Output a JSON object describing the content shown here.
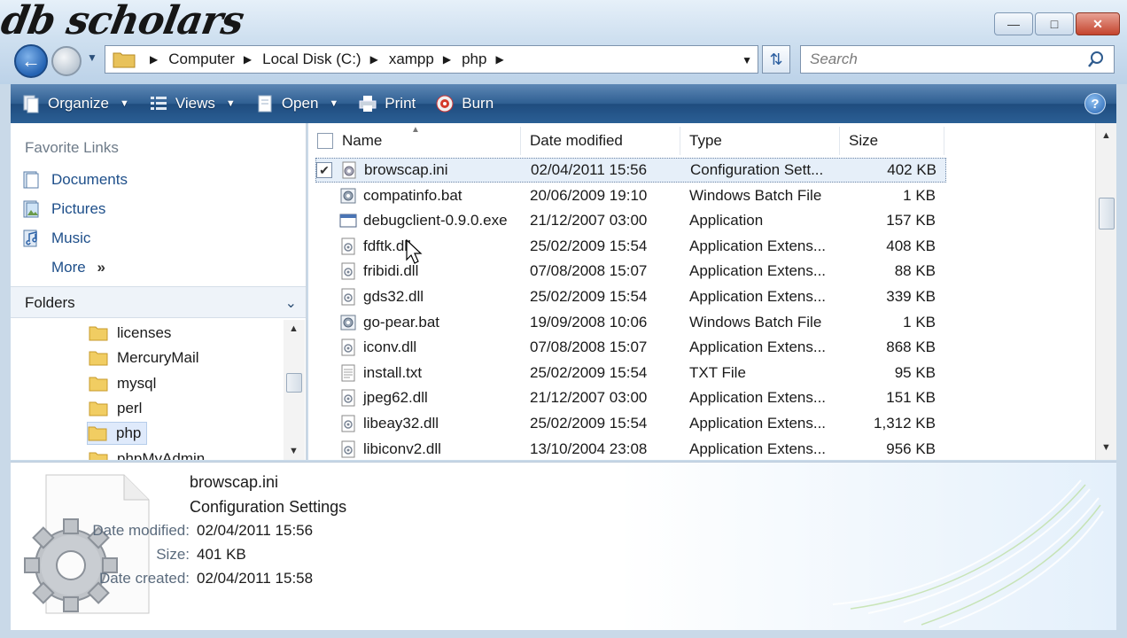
{
  "watermark": "db scholars",
  "address": {
    "crumbs": [
      "Computer",
      "Local Disk (C:)",
      "xampp",
      "php"
    ]
  },
  "search": {
    "placeholder": "Search"
  },
  "toolbar": {
    "organize": "Organize",
    "views": "Views",
    "open": "Open",
    "print": "Print",
    "burn": "Burn"
  },
  "nav": {
    "favorites_heading": "Favorite Links",
    "links": [
      "Documents",
      "Pictures",
      "Music"
    ],
    "more": "More",
    "folders_label": "Folders",
    "tree": [
      "licenses",
      "MercuryMail",
      "mysql",
      "perl",
      "php",
      "phpMyAdmin"
    ],
    "selected_folder": "php"
  },
  "columns": {
    "name": "Name",
    "date": "Date modified",
    "type": "Type",
    "size": "Size"
  },
  "files": [
    {
      "name": "browscap.ini",
      "date": "02/04/2011 15:56",
      "type": "Configuration Sett...",
      "size": "402 KB",
      "icon": "settings-file-icon",
      "selected": true
    },
    {
      "name": "compatinfo.bat",
      "date": "20/06/2009 19:10",
      "type": "Windows Batch File",
      "size": "1 KB",
      "icon": "batch-file-icon"
    },
    {
      "name": "debugclient-0.9.0.exe",
      "date": "21/12/2007 03:00",
      "type": "Application",
      "size": "157 KB",
      "icon": "exe-file-icon"
    },
    {
      "name": "fdftk.dll",
      "date": "25/02/2009 15:54",
      "type": "Application Extens...",
      "size": "408 KB",
      "icon": "dll-file-icon"
    },
    {
      "name": "fribidi.dll",
      "date": "07/08/2008 15:07",
      "type": "Application Extens...",
      "size": "88 KB",
      "icon": "dll-file-icon"
    },
    {
      "name": "gds32.dll",
      "date": "25/02/2009 15:54",
      "type": "Application Extens...",
      "size": "339 KB",
      "icon": "dll-file-icon"
    },
    {
      "name": "go-pear.bat",
      "date": "19/09/2008 10:06",
      "type": "Windows Batch File",
      "size": "1 KB",
      "icon": "batch-file-icon"
    },
    {
      "name": "iconv.dll",
      "date": "07/08/2008 15:07",
      "type": "Application Extens...",
      "size": "868 KB",
      "icon": "dll-file-icon"
    },
    {
      "name": "install.txt",
      "date": "25/02/2009 15:54",
      "type": "TXT File",
      "size": "95 KB",
      "icon": "text-file-icon"
    },
    {
      "name": "jpeg62.dll",
      "date": "21/12/2007 03:00",
      "type": "Application Extens...",
      "size": "151 KB",
      "icon": "dll-file-icon"
    },
    {
      "name": "libeay32.dll",
      "date": "25/02/2009 15:54",
      "type": "Application Extens...",
      "size": "1,312 KB",
      "icon": "dll-file-icon"
    },
    {
      "name": "libiconv2.dll",
      "date": "13/10/2004 23:08",
      "type": "Application Extens...",
      "size": "956 KB",
      "icon": "dll-file-icon"
    }
  ],
  "details": {
    "name": "browscap.ini",
    "type": "Configuration Settings",
    "modified_label": "Date modified:",
    "modified": "02/04/2011 15:56",
    "size_label": "Size:",
    "size": "401 KB",
    "created_label": "Date created:",
    "created": "02/04/2011 15:58"
  }
}
